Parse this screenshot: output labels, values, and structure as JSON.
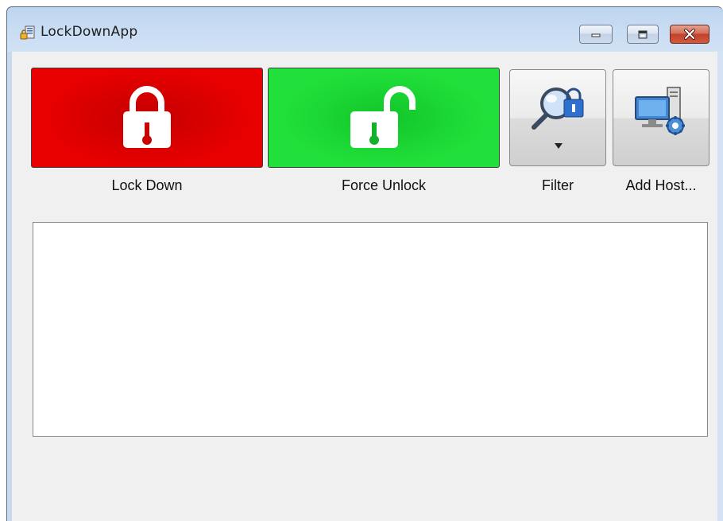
{
  "window": {
    "title": "LockDownApp",
    "controls": {
      "minimize": "minimize-icon",
      "maximize": "maximize-icon",
      "close": "close-icon"
    }
  },
  "toolbar": {
    "lock_down": {
      "label": "Lock Down",
      "icon": "padlock-closed-icon",
      "color": "#e00000"
    },
    "force_unlock": {
      "label": "Force Unlock",
      "icon": "padlock-open-icon",
      "color": "#1ed838"
    },
    "filter": {
      "label": "Filter",
      "icon": "magnifier-lock-icon",
      "dropdown_icon": "dropdown-arrow-icon"
    },
    "add_host": {
      "label": "Add Host...",
      "icon": "computer-gear-icon"
    }
  },
  "host_list": {
    "items": []
  }
}
